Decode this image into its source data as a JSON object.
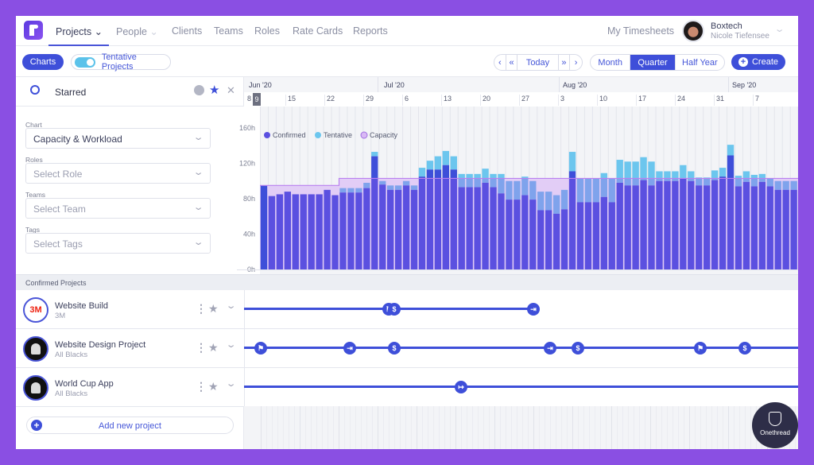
{
  "nav": {
    "items": [
      "Projects",
      "People",
      "Clients",
      "Teams",
      "Roles",
      "Rate Cards",
      "Reports"
    ],
    "timesheets": "My Timesheets",
    "company": "Boxtech",
    "user": "Nicole Tiefensee"
  },
  "toolbar": {
    "charts": "Charts",
    "tentative": "Tentative Projects",
    "tentative_on": true,
    "today": "Today",
    "views": [
      "Month",
      "Quarter",
      "Half Year"
    ],
    "active_view": "Quarter",
    "create": "Create"
  },
  "search": {
    "value": "Starred"
  },
  "timeline": {
    "months": [
      "Jun '20",
      "Jul '20",
      "Aug '20",
      "Sep '20"
    ],
    "weeks": [
      "8",
      "15",
      "22",
      "29",
      "6",
      "13",
      "20",
      "27",
      "3",
      "10",
      "17",
      "24",
      "31",
      "7"
    ],
    "today": "9"
  },
  "filters": {
    "chart_label": "Chart",
    "chart_value": "Capacity & Workload",
    "roles_label": "Roles",
    "roles_placeholder": "Select Role",
    "teams_label": "Teams",
    "teams_placeholder": "Select Team",
    "tags_label": "Tags",
    "tags_placeholder": "Select Tags"
  },
  "chart_data": {
    "type": "bar",
    "stacked": true,
    "ylim": [
      0,
      160
    ],
    "yticks": [
      "0h",
      "40h",
      "80h",
      "120h",
      "160h"
    ],
    "legend": [
      "Confirmed",
      "Tentative",
      "Capacity"
    ],
    "legend_position": "top-left",
    "colors": {
      "confirmed": "#5b50e0",
      "tentative": "#6cc6ee",
      "capacity": "#b980f0"
    },
    "confirmed": [
      95,
      83,
      85,
      88,
      85,
      85,
      85,
      85,
      90,
      84,
      87,
      87,
      87,
      92,
      128,
      96,
      90,
      90,
      95,
      90,
      105,
      113,
      113,
      118,
      113,
      93,
      93,
      93,
      98,
      93,
      86,
      79,
      79,
      84,
      79,
      67,
      67,
      63,
      68,
      111,
      76,
      76,
      76,
      82,
      76,
      98,
      95,
      95,
      101,
      95,
      100,
      100,
      100,
      103,
      100,
      95,
      95,
      101,
      105,
      129,
      94,
      99,
      94,
      99,
      94,
      90,
      90,
      90,
      94,
      90
    ],
    "total": [
      95,
      83,
      85,
      88,
      85,
      85,
      85,
      85,
      90,
      84,
      92,
      92,
      92,
      98,
      133,
      100,
      95,
      95,
      100,
      95,
      115,
      123,
      128,
      134,
      128,
      108,
      108,
      108,
      114,
      108,
      108,
      100,
      100,
      105,
      100,
      88,
      88,
      84,
      90,
      133,
      103,
      103,
      103,
      109,
      103,
      124,
      122,
      122,
      127,
      122,
      111,
      111,
      111,
      118,
      111,
      104,
      104,
      112,
      115,
      141,
      106,
      111,
      107,
      108,
      103,
      100,
      100,
      100,
      104,
      99
    ],
    "capacity": [
      95,
      95,
      95,
      95,
      95,
      95,
      95,
      95,
      95,
      95,
      103,
      103,
      103,
      103,
      103,
      103,
      103,
      103,
      103,
      103,
      103,
      103,
      103,
      103,
      103,
      103,
      103,
      103,
      103,
      103,
      103,
      103,
      103,
      103,
      103,
      103,
      103,
      103,
      103,
      103,
      103,
      103,
      103,
      103,
      103,
      103,
      103,
      103,
      103,
      103,
      103,
      103,
      103,
      103,
      103,
      103,
      103,
      103,
      103,
      103,
      103,
      103,
      103,
      103,
      103,
      103,
      103,
      103,
      103,
      103
    ]
  },
  "projects": {
    "section": "Confirmed Projects",
    "items": [
      {
        "title": "Website Build",
        "client": "3M",
        "logo": "3M",
        "end_open": false,
        "end": "2020-07-27",
        "milestones": [
          {
            "date": "2020-07-01",
            "icon": "flag"
          },
          {
            "date": "2020-07-02",
            "icon": "dollar"
          },
          {
            "date": "2020-07-27",
            "icon": "end"
          }
        ]
      },
      {
        "title": "Website Design Project",
        "client": "All Blacks",
        "logo": "",
        "end_open": true,
        "milestones": [
          {
            "date": "2020-06-08",
            "icon": "flag"
          },
          {
            "date": "2020-06-24",
            "icon": "end"
          },
          {
            "date": "2020-07-02",
            "icon": "dollar"
          },
          {
            "date": "2020-07-30",
            "icon": "end"
          },
          {
            "date": "2020-08-04",
            "icon": "dollar"
          },
          {
            "date": "2020-08-26",
            "icon": "flag"
          },
          {
            "date": "2020-09-03",
            "icon": "dollar"
          }
        ]
      },
      {
        "title": "World Cup App",
        "client": "All Blacks",
        "logo": "",
        "end_open": true,
        "milestones": [
          {
            "date": "2020-07-14",
            "icon": "start"
          }
        ]
      }
    ],
    "add": "Add new project"
  },
  "watermark": "Onethread"
}
